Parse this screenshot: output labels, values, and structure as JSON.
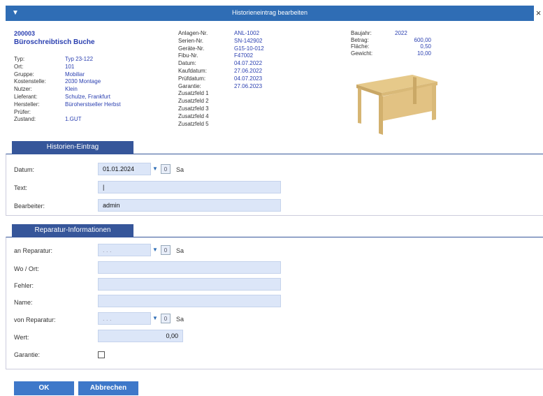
{
  "window": {
    "title": "Historieneintrag bearbeiten",
    "menu_icon": "▼",
    "close": "×"
  },
  "asset": {
    "number": "200003",
    "name": "Büroschreibtisch Buche",
    "col1": [
      {
        "label": "Typ:",
        "value": "Typ 23-122"
      },
      {
        "label": "Ort:",
        "value": "101"
      },
      {
        "label": "Gruppe:",
        "value": "Mobiliar"
      },
      {
        "label": "Kostenstelle:",
        "value": "2030 Montage"
      },
      {
        "label": "Nutzer:",
        "value": "Klein"
      },
      {
        "label": "Lieferant:",
        "value": "Schulze, Frankfurt"
      },
      {
        "label": "Hersteller:",
        "value": "Büroherstseller Herbst"
      },
      {
        "label": "Prüfer:",
        "value": ""
      },
      {
        "label": "Zustand:",
        "value": "1.GUT"
      }
    ],
    "col2": [
      {
        "label": "Anlagen-Nr.",
        "value": "ANL-1002"
      },
      {
        "label": "Serien-Nr.",
        "value": "SN-142902"
      },
      {
        "label": "Geräte-Nr.",
        "value": "G15-10-012"
      },
      {
        "label": "Fibu-Nr.",
        "value": "F47002"
      },
      {
        "label": "Datum:",
        "value": "04.07.2022"
      },
      {
        "label": "Kaufdatum:",
        "value": "27.06.2022"
      },
      {
        "label": "Prüfdatum:",
        "value": "04.07.2023"
      },
      {
        "label": "Garantie:",
        "value": "27.06.2023"
      },
      {
        "label": "Zusatzfeld 1",
        "value": ""
      },
      {
        "label": "Zusatzfeld 2",
        "value": ""
      },
      {
        "label": "Zusatzfeld 3",
        "value": ""
      },
      {
        "label": "Zusatzfeld 4",
        "value": ""
      },
      {
        "label": "Zusatzfeld 5",
        "value": ""
      }
    ],
    "col3": [
      {
        "label": "Baujahr:",
        "value": "2022"
      },
      {
        "label": "Betrag:",
        "value": "600,00"
      },
      {
        "label": "Fläche:",
        "value": "0,50"
      },
      {
        "label": "Gewicht:",
        "value": "10,00"
      }
    ]
  },
  "history": {
    "tab": "Historien-Eintrag",
    "date_label": "Datum:",
    "date_value": "01.01.2024",
    "weekday": "Sa",
    "text_label": "Text:",
    "text_value": "|",
    "editor_label": "Bearbeiter:",
    "editor_value": "admin"
  },
  "repair": {
    "tab": "Reparatur-Informationen",
    "to_label": "an Reparatur:",
    "to_value": ". . .",
    "to_weekday": "Sa",
    "where_label": "Wo / Ort:",
    "error_label": "Fehler:",
    "name_label": "Name:",
    "from_label": "von Reparatur:",
    "from_value": ". . .",
    "from_weekday": "Sa",
    "value_label": "Wert:",
    "value_value": "0,00",
    "warranty_label": "Garantie:"
  },
  "buttons": {
    "ok": "OK",
    "cancel": "Abbrechen"
  },
  "spin_value": "0",
  "accent": "#2f6db5"
}
